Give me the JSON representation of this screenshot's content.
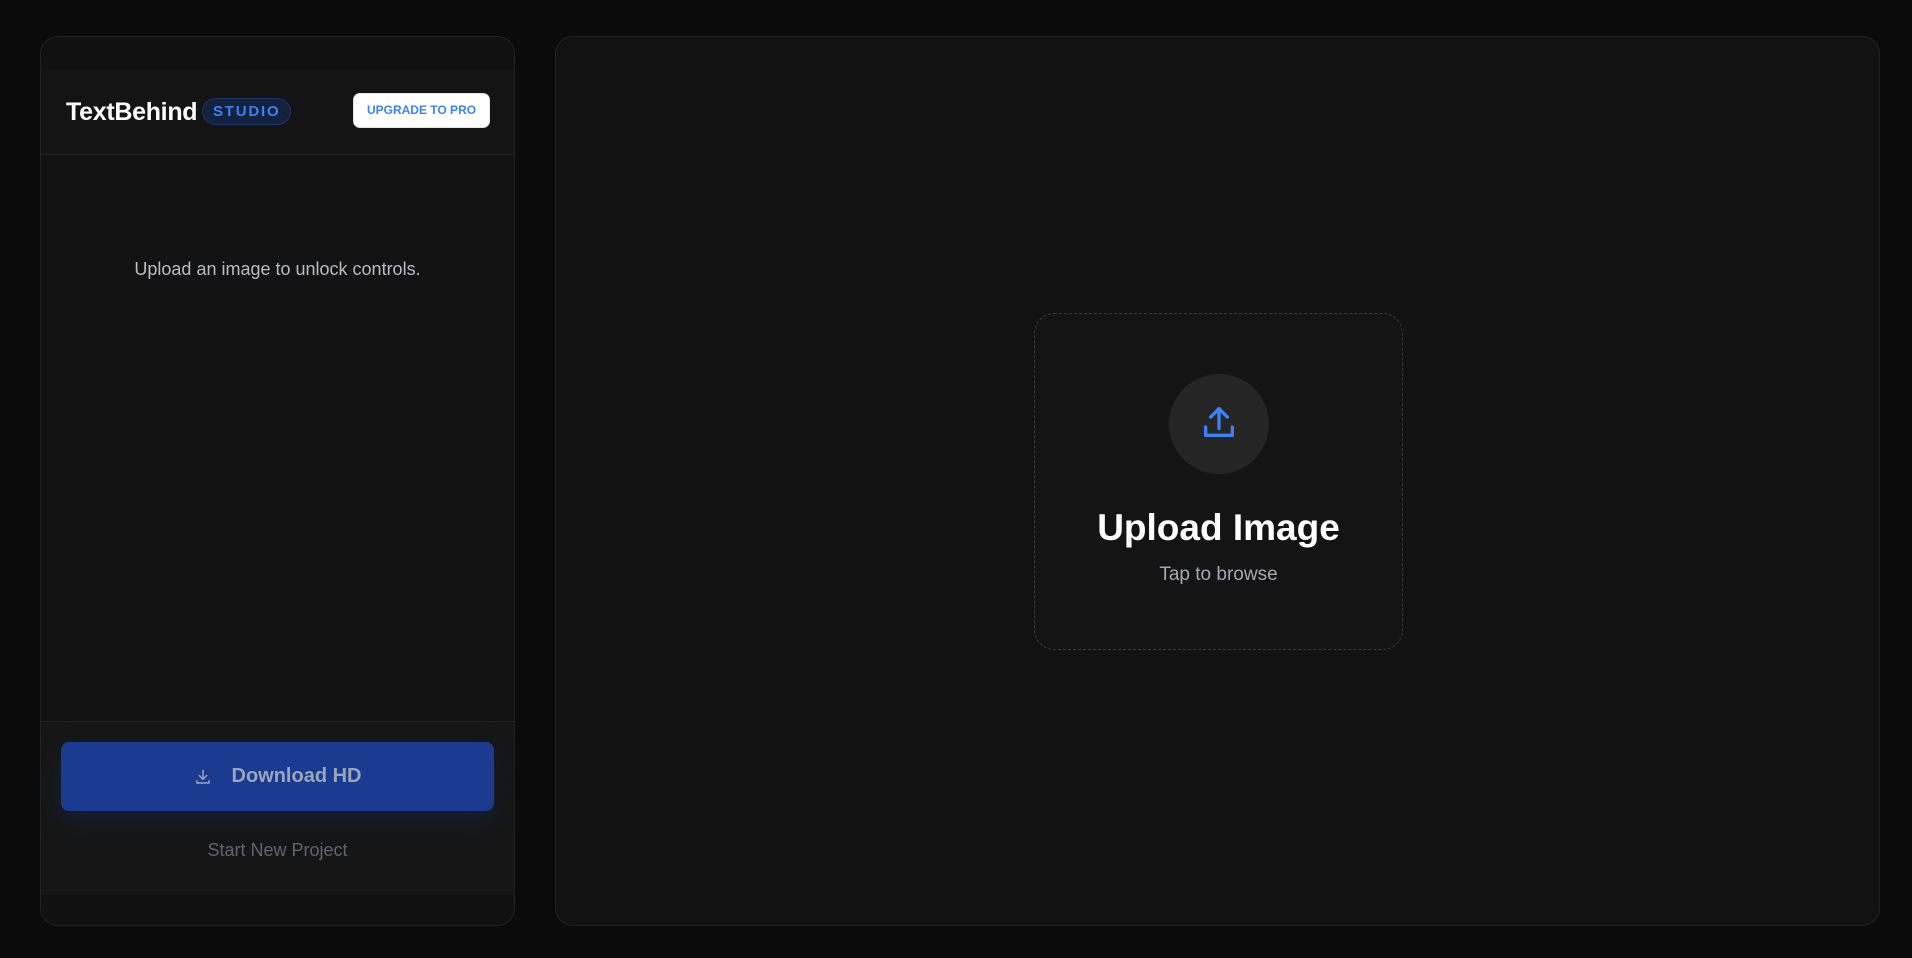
{
  "brand": {
    "name": "TextBehind",
    "badge": "STUDIO"
  },
  "header": {
    "upgrade_label": "UPGRADE TO PRO"
  },
  "sidebar": {
    "empty_message": "Upload an image to unlock controls."
  },
  "footer": {
    "download_label": "Download HD",
    "download_icon": "download-icon",
    "new_project_label": "Start New Project"
  },
  "upload": {
    "icon": "upload-icon",
    "title": "Upload Image",
    "subtitle": "Tap to browse"
  },
  "colors": {
    "accent": "#3b82f6",
    "download_button": "#1a3b8f",
    "background": "#0b0b0b",
    "panel": "#121212"
  }
}
